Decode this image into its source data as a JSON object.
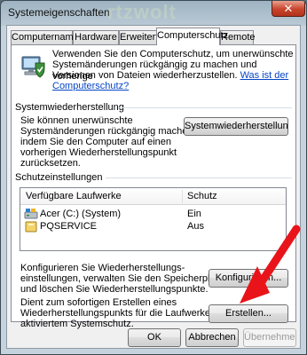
{
  "window": {
    "title": "Systemeigenschaften",
    "watermark": "rtzwolt",
    "close_glyph": "✕"
  },
  "tabs": [
    {
      "label": "Computername",
      "active": false
    },
    {
      "label": "Hardware",
      "active": false
    },
    {
      "label": "Erweitert",
      "active": false
    },
    {
      "label": "Computerschutz",
      "active": true
    },
    {
      "label": "Remote",
      "active": false
    }
  ],
  "intro": {
    "line1": "Verwenden Sie den Computerschutz, um unerwünschte",
    "line2": "Systemänderungen rückgängig zu machen und vorherige",
    "line3_text": "Versionen von Dateien wiederherzustellen. ",
    "line3_link": "Was ist der",
    "line4_link": "Computerschutz?"
  },
  "restore": {
    "heading": "Systemwiederherstellung",
    "line1": "Sie können unerwünschte",
    "line2": "Systemänderungen rückgängig machen,",
    "line3": "indem Sie den Computer auf einen",
    "line4": "vorherigen Wiederherstellungspunkt",
    "line5": "zurücksetzen.",
    "button_label": "Systemwiederherstellung..."
  },
  "protection": {
    "heading": "Schutzeinstellungen",
    "columns": {
      "drives": "Verfügbare Laufwerke",
      "protection": "Schutz"
    },
    "rows": [
      {
        "drive": "Acer (C:) (System)",
        "status": "Ein",
        "icon": "system-drive-icon"
      },
      {
        "drive": "PQSERVICE",
        "status": "Aus",
        "icon": "drive-icon"
      }
    ],
    "configure_line1": "Konfigurieren Sie Wiederherstellungs-",
    "configure_line2": "einstellungen, verwalten Sie den Speicherplatz,",
    "configure_line3": "und löschen Sie Wiederherstellungspunkte.",
    "configure_button": "Konfigurieren...",
    "create_line1": "Dient zum sofortigen Erstellen eines",
    "create_line2": "Wiederherstellungspunkts für die Laufwerke mit",
    "create_line3": "aktiviertem Systemschutz.",
    "create_button": "Erstellen..."
  },
  "footer": {
    "ok": "OK",
    "cancel": "Abbrechen",
    "apply": "Übernehmen"
  },
  "colors": {
    "annotation_arrow": "#e8141a",
    "link": "#0645c6"
  }
}
